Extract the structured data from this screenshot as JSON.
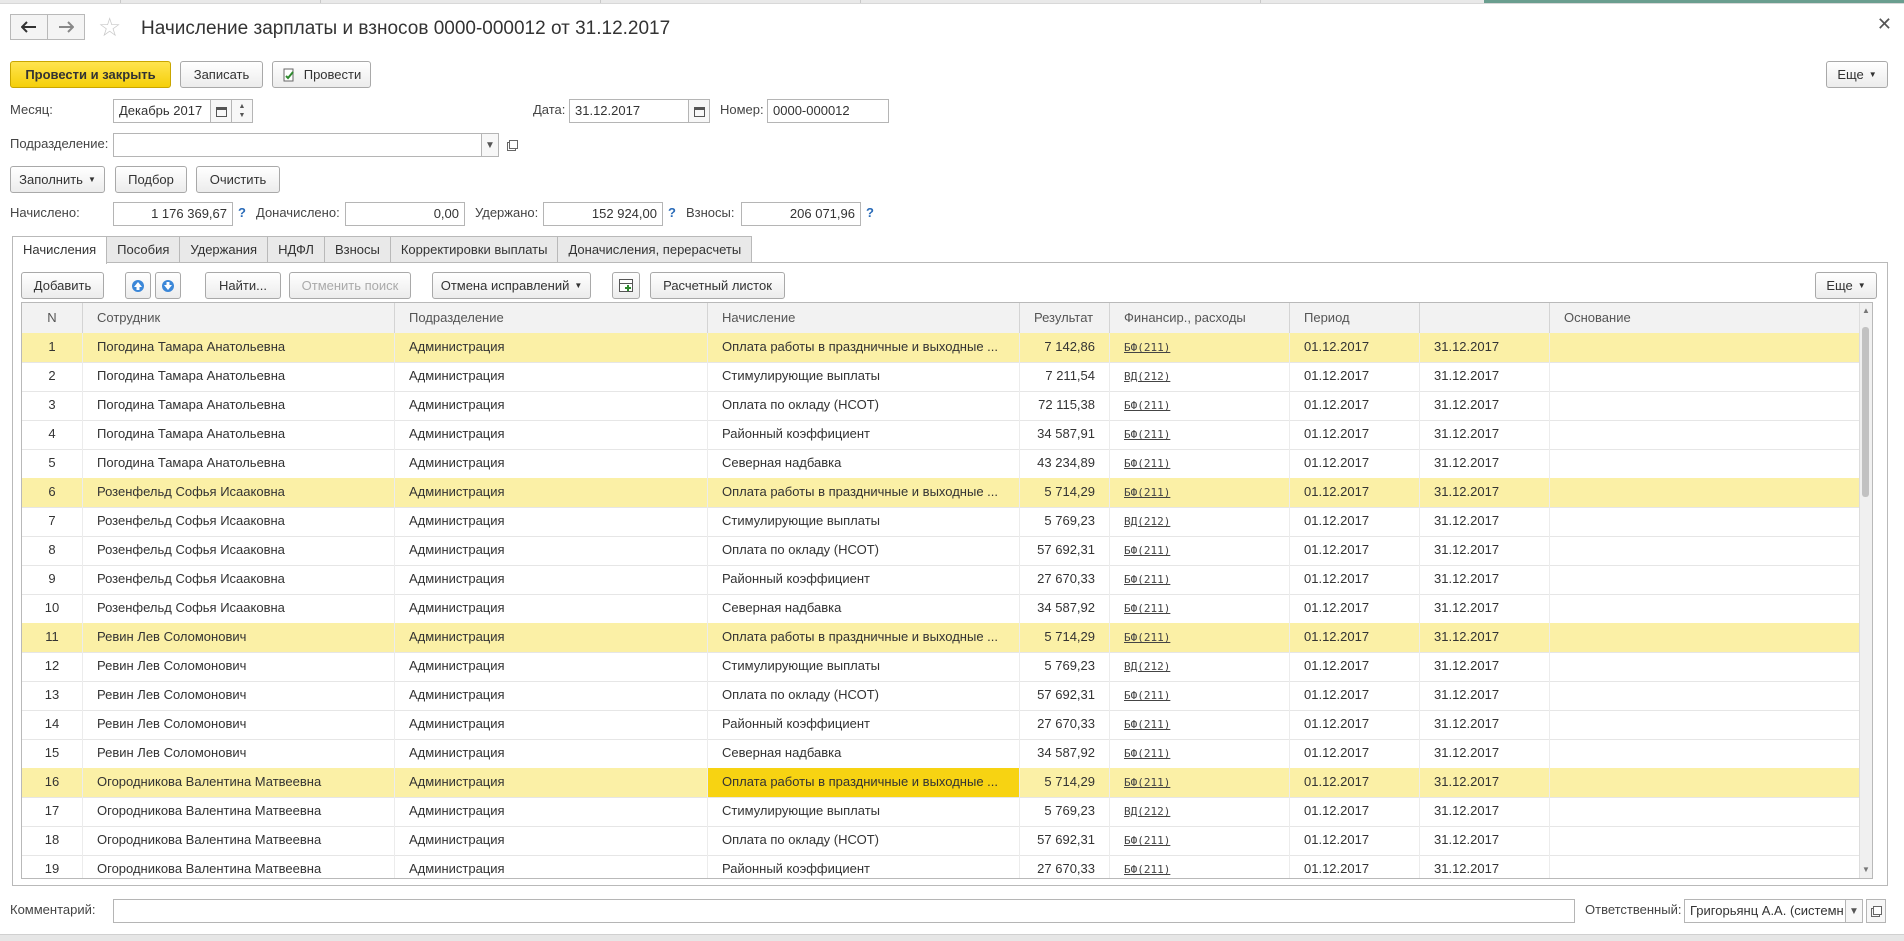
{
  "header": {
    "title": "Начисление зарплаты и взносов 0000-000012 от 31.12.2017",
    "back_icon": "arrow-left-icon",
    "forward_icon": "arrow-right-icon",
    "favorite_icon": "star-icon",
    "close_icon": "close-icon"
  },
  "toolbar": {
    "post_close": "Провести и закрыть",
    "save": "Записать",
    "post": "Провести",
    "more": "Еще"
  },
  "form": {
    "month_label": "Месяц:",
    "month_value": "Декабрь 2017",
    "date_label": "Дата:",
    "date_value": "31.12.2017",
    "number_label": "Номер:",
    "number_value": "0000-000012",
    "dept_label": "Подразделение:",
    "dept_value": "",
    "fill": "Заполнить",
    "pick": "Подбор",
    "clear": "Очистить",
    "accrued_label": "Начислено:",
    "accrued_value": "1 176 369,67",
    "extra_label": "Доначислено:",
    "extra_value": "0,00",
    "withheld_label": "Удержано:",
    "withheld_value": "152 924,00",
    "contrib_label": "Взносы:",
    "contrib_value": "206 071,96",
    "help": "?"
  },
  "tabs": [
    "Начисления",
    "Пособия",
    "Удержания",
    "НДФЛ",
    "Взносы",
    "Корректировки выплаты",
    "Доначисления, перерасчеты"
  ],
  "table_toolbar": {
    "add": "Добавить",
    "find": "Найти...",
    "cancel_search": "Отменить поиск",
    "cancel_fixes": "Отмена исправлений",
    "payslip": "Расчетный листок",
    "more": "Еще"
  },
  "columns": [
    "N",
    "Сотрудник",
    "Подразделение",
    "Начисление",
    "Результат",
    "Финансир., расходы",
    "Период",
    "",
    "Основание"
  ],
  "rows": [
    {
      "n": "1",
      "emp": "Погодина Тамара Анатольевна",
      "dept": "Администрация",
      "acc": "Оплата работы в праздничные и выходные ...",
      "res": "7 142,86",
      "fin": "БФ(211)",
      "from": "01.12.2017",
      "to": "31.12.2017",
      "hl": true
    },
    {
      "n": "2",
      "emp": "Погодина Тамара Анатольевна",
      "dept": "Администрация",
      "acc": "Стимулирующие выплаты",
      "res": "7 211,54",
      "fin": "ВД(212)",
      "from": "01.12.2017",
      "to": "31.12.2017",
      "hl": false
    },
    {
      "n": "3",
      "emp": "Погодина Тамара Анатольевна",
      "dept": "Администрация",
      "acc": "Оплата по окладу (НСОТ)",
      "res": "72 115,38",
      "fin": "БФ(211)",
      "from": "01.12.2017",
      "to": "31.12.2017",
      "hl": false
    },
    {
      "n": "4",
      "emp": "Погодина Тамара Анатольевна",
      "dept": "Администрация",
      "acc": "Районный коэффициент",
      "res": "34 587,91",
      "fin": "БФ(211)",
      "from": "01.12.2017",
      "to": "31.12.2017",
      "hl": false
    },
    {
      "n": "5",
      "emp": "Погодина Тамара Анатольевна",
      "dept": "Администрация",
      "acc": "Северная надбавка",
      "res": "43 234,89",
      "fin": "БФ(211)",
      "from": "01.12.2017",
      "to": "31.12.2017",
      "hl": false
    },
    {
      "n": "6",
      "emp": "Розенфельд Софья Исааковна",
      "dept": "Администрация",
      "acc": "Оплата работы в праздничные и выходные ...",
      "res": "5 714,29",
      "fin": "БФ(211)",
      "from": "01.12.2017",
      "to": "31.12.2017",
      "hl": true
    },
    {
      "n": "7",
      "emp": "Розенфельд Софья Исааковна",
      "dept": "Администрация",
      "acc": "Стимулирующие выплаты",
      "res": "5 769,23",
      "fin": "ВД(212)",
      "from": "01.12.2017",
      "to": "31.12.2017",
      "hl": false
    },
    {
      "n": "8",
      "emp": "Розенфельд Софья Исааковна",
      "dept": "Администрация",
      "acc": "Оплата по окладу (НСОТ)",
      "res": "57 692,31",
      "fin": "БФ(211)",
      "from": "01.12.2017",
      "to": "31.12.2017",
      "hl": false
    },
    {
      "n": "9",
      "emp": "Розенфельд Софья Исааковна",
      "dept": "Администрация",
      "acc": "Районный коэффициент",
      "res": "27 670,33",
      "fin": "БФ(211)",
      "from": "01.12.2017",
      "to": "31.12.2017",
      "hl": false
    },
    {
      "n": "10",
      "emp": "Розенфельд Софья Исааковна",
      "dept": "Администрация",
      "acc": "Северная надбавка",
      "res": "34 587,92",
      "fin": "БФ(211)",
      "from": "01.12.2017",
      "to": "31.12.2017",
      "hl": false
    },
    {
      "n": "11",
      "emp": "Ревин Лев Соломонович",
      "dept": "Администрация",
      "acc": "Оплата работы в праздничные и выходные ...",
      "res": "5 714,29",
      "fin": "БФ(211)",
      "from": "01.12.2017",
      "to": "31.12.2017",
      "hl": true
    },
    {
      "n": "12",
      "emp": "Ревин Лев Соломонович",
      "dept": "Администрация",
      "acc": "Стимулирующие выплаты",
      "res": "5 769,23",
      "fin": "ВД(212)",
      "from": "01.12.2017",
      "to": "31.12.2017",
      "hl": false
    },
    {
      "n": "13",
      "emp": "Ревин Лев Соломонович",
      "dept": "Администрация",
      "acc": "Оплата по окладу (НСОТ)",
      "res": "57 692,31",
      "fin": "БФ(211)",
      "from": "01.12.2017",
      "to": "31.12.2017",
      "hl": false
    },
    {
      "n": "14",
      "emp": "Ревин Лев Соломонович",
      "dept": "Администрация",
      "acc": "Районный коэффициент",
      "res": "27 670,33",
      "fin": "БФ(211)",
      "from": "01.12.2017",
      "to": "31.12.2017",
      "hl": false
    },
    {
      "n": "15",
      "emp": "Ревин Лев Соломонович",
      "dept": "Администрация",
      "acc": "Северная надбавка",
      "res": "34 587,92",
      "fin": "БФ(211)",
      "from": "01.12.2017",
      "to": "31.12.2017",
      "hl": false
    },
    {
      "n": "16",
      "emp": "Огородникова Валентина Матвеевна",
      "dept": "Администрация",
      "acc": "Оплата работы в праздничные и выходные ...",
      "res": "5 714,29",
      "fin": "БФ(211)",
      "from": "01.12.2017",
      "to": "31.12.2017",
      "hl": true,
      "sel": true
    },
    {
      "n": "17",
      "emp": "Огородникова Валентина Матвеевна",
      "dept": "Администрация",
      "acc": "Стимулирующие выплаты",
      "res": "5 769,23",
      "fin": "ВД(212)",
      "from": "01.12.2017",
      "to": "31.12.2017",
      "hl": false
    },
    {
      "n": "18",
      "emp": "Огородникова Валентина Матвеевна",
      "dept": "Администрация",
      "acc": "Оплата по окладу (НСОТ)",
      "res": "57 692,31",
      "fin": "БФ(211)",
      "from": "01.12.2017",
      "to": "31.12.2017",
      "hl": false
    },
    {
      "n": "19",
      "emp": "Огородникова Валентина Матвеевна",
      "dept": "Администрация",
      "acc": "Районный коэффициент",
      "res": "27 670,33",
      "fin": "БФ(211)",
      "from": "01.12.2017",
      "to": "31.12.2017",
      "hl": false
    }
  ],
  "footer": {
    "comment_label": "Комментарий:",
    "comment_value": "",
    "responsible_label": "Ответственный:",
    "responsible_value": "Григорьянц А.А. (системн"
  },
  "colors": {
    "primary_button": "#f5cf0a",
    "highlight_row": "#fbf0a6",
    "selected_cell": "#f7d312",
    "help_link": "#2a6bb8"
  }
}
